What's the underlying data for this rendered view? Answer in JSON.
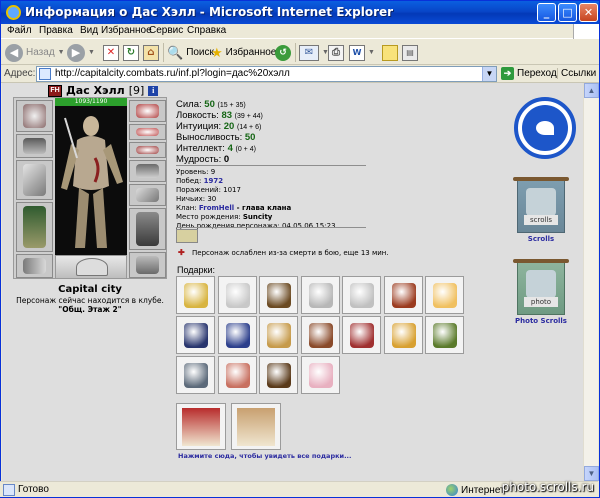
{
  "window": {
    "title": "Информация о Дас Хэлл - Microsoft Internet Explorer",
    "controls": {
      "minimize": "_",
      "maximize": "□",
      "close": "✕"
    }
  },
  "menu": [
    "Файл",
    "Правка",
    "Вид",
    "Избранное",
    "Сервис",
    "Справка"
  ],
  "toolbar": {
    "back_label": "Назад",
    "search_label": "Поиск",
    "favorites_label": "Избранное"
  },
  "address": {
    "label": "Адрес:",
    "url": "http://capitalcity.combats.ru/inf.pl?login=дас%20хэлл",
    "go_label": "Переход",
    "links_label": "Ссылки"
  },
  "character": {
    "name": "Дас Хэлл",
    "level": "[9]",
    "hp": "1093/1190",
    "city": "Capital city",
    "location_line1": "Персонаж сейчас находится в клубе.",
    "location_line2": "\"Общ. Этаж 2\""
  },
  "stats": [
    {
      "label": "Сила:",
      "value": "50",
      "bonus": "(15 + 35)",
      "color": "#156615"
    },
    {
      "label": "Ловкость:",
      "value": "83",
      "bonus": "(39 + 44)",
      "color": "#156615"
    },
    {
      "label": "Интуиция:",
      "value": "20",
      "bonus": "(14 + 6)",
      "color": "#156615"
    },
    {
      "label": "Выносливость:",
      "value": "50",
      "bonus": "",
      "color": "#156615"
    },
    {
      "label": "Интеллект:",
      "value": "4",
      "bonus": "(0 + 4)",
      "color": "#156615"
    },
    {
      "label": "Мудрость:",
      "value": "0",
      "bonus": "",
      "color": "#000000"
    }
  ],
  "details": {
    "level": "Уровень: 9",
    "wins_label": "Побед: ",
    "wins": "1972",
    "losses": "Поражений: 1017",
    "draws": "Ничьих: 30",
    "clan_label": "Клан: ",
    "clan_name": "FromHell",
    "clan_role": " - глава клана",
    "birthplace_label": "Место рождения: ",
    "birthplace": "Suncity",
    "birthday": "День рождения персонажа: 04.05.06 15:23"
  },
  "weakness_text": "Персонаж ослаблен из-за смерти в бою, еще 13 мин.",
  "gifts_label": "Подарки:",
  "see_all_gifts": "Нажмите сюда, чтобы увидеть все подарки...",
  "side": {
    "scrolls_label": "Scrolls",
    "photo_scrolls_label": "Photo Scrolls",
    "banner1_tag": "scrolls",
    "banner2_tag": "photo"
  },
  "status": {
    "ready": "Готово",
    "zone": "Интернет"
  },
  "watermark": "photo.scrolls.ru",
  "gift_colors": [
    "#d8b440",
    "#c8c8c8",
    "#6b4a22",
    "#b7b7b7",
    "#c0c0c0",
    "#9b3b1f",
    "#f0c060",
    "#28356e",
    "#2c3f8c",
    "#c69a4a",
    "#8a4a2a",
    "#a03030",
    "#d8a030",
    "#5a7a2a",
    "#5c6a7a",
    "#c87060",
    "#5a3a1a",
    "#e8b0c0"
  ],
  "card_colors": [
    "#b82c2c",
    "#c8a070"
  ]
}
